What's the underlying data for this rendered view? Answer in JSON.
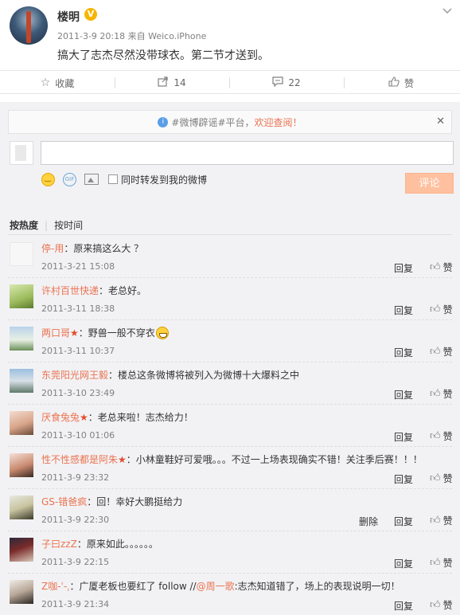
{
  "post": {
    "author": "楼明",
    "verified_badge": "V",
    "meta": "2011-3-9 20:18 来自 Weico.iPhone",
    "text": "搞大了志杰尽然没带球衣。第二节才送到。"
  },
  "actions": {
    "favorite": "收藏",
    "repost": "14",
    "comment": "22",
    "like": "赞"
  },
  "rumor_bar": {
    "text": "#微博辟谣#平台，",
    "link": "欢迎查阅！"
  },
  "compose": {
    "repost_label": "同时转发到我的微博",
    "submit": "评论"
  },
  "sort": {
    "hot": "按热度",
    "time": "按时间"
  },
  "comments": [
    {
      "user": "停-用",
      "text": "：原来搞这么大 ？",
      "time": "2011-3-21 15:08",
      "reply": "回复",
      "like": "赞"
    },
    {
      "user": "许村百世快递",
      "text": "：老总好。",
      "time": "2011-3-11 18:38",
      "reply": "回复",
      "like": "赞"
    },
    {
      "user": "两口哥",
      "badge": "★",
      "text": "：野兽一般不穿衣",
      "time": "2011-3-11 10:37",
      "reply": "回复",
      "like": "赞"
    },
    {
      "user": "东莞阳光网王毅",
      "text": "：楼总这条微博将被列入为微博十大爆料之中",
      "time": "2011-3-10 23:49",
      "reply": "回复",
      "like": "赞"
    },
    {
      "user": "厌食兔兔",
      "badge": "★",
      "text": "：老总来啦！志杰给力！",
      "time": "2011-3-10 01:06",
      "reply": "回复",
      "like": "赞"
    },
    {
      "user": "性不性感都是阿朱",
      "badge": "★",
      "text": "：小林童鞋好可爱哦。。。不过一上场表现确实不错！关注季后赛！！！",
      "time": "2011-3-9 23:32",
      "reply": "回复",
      "like": "赞"
    },
    {
      "user": "GS-错爸疯",
      "text": "：回！幸好大鹏挺给力",
      "time": "2011-3-9 22:30",
      "delete": "删除",
      "reply": "回复",
      "like": "赞"
    },
    {
      "user": "子曰zzZ",
      "text": "：原来如此。。。。。。",
      "time": "2011-3-9 22:15",
      "reply": "回复",
      "like": "赞"
    },
    {
      "user": "Z咖-ˈ-ˌ",
      "text": "：广厦老板也要红了 follow //",
      "mention": "@周一歌",
      "text2": ":志杰知道错了，场上的表现说明一切！",
      "time": "2011-3-9 21:34",
      "reply": "回复",
      "like": "赞"
    }
  ],
  "icons": {
    "favorite": "star-outline-icon",
    "repost": "share-arrow-icon",
    "comment": "speech-bubble-icon",
    "like": "thumbs-up-icon"
  },
  "colors": {
    "accent": "#eb7350",
    "submit_bg": "#ffc09f",
    "area_bg": "#f2f2f5"
  }
}
